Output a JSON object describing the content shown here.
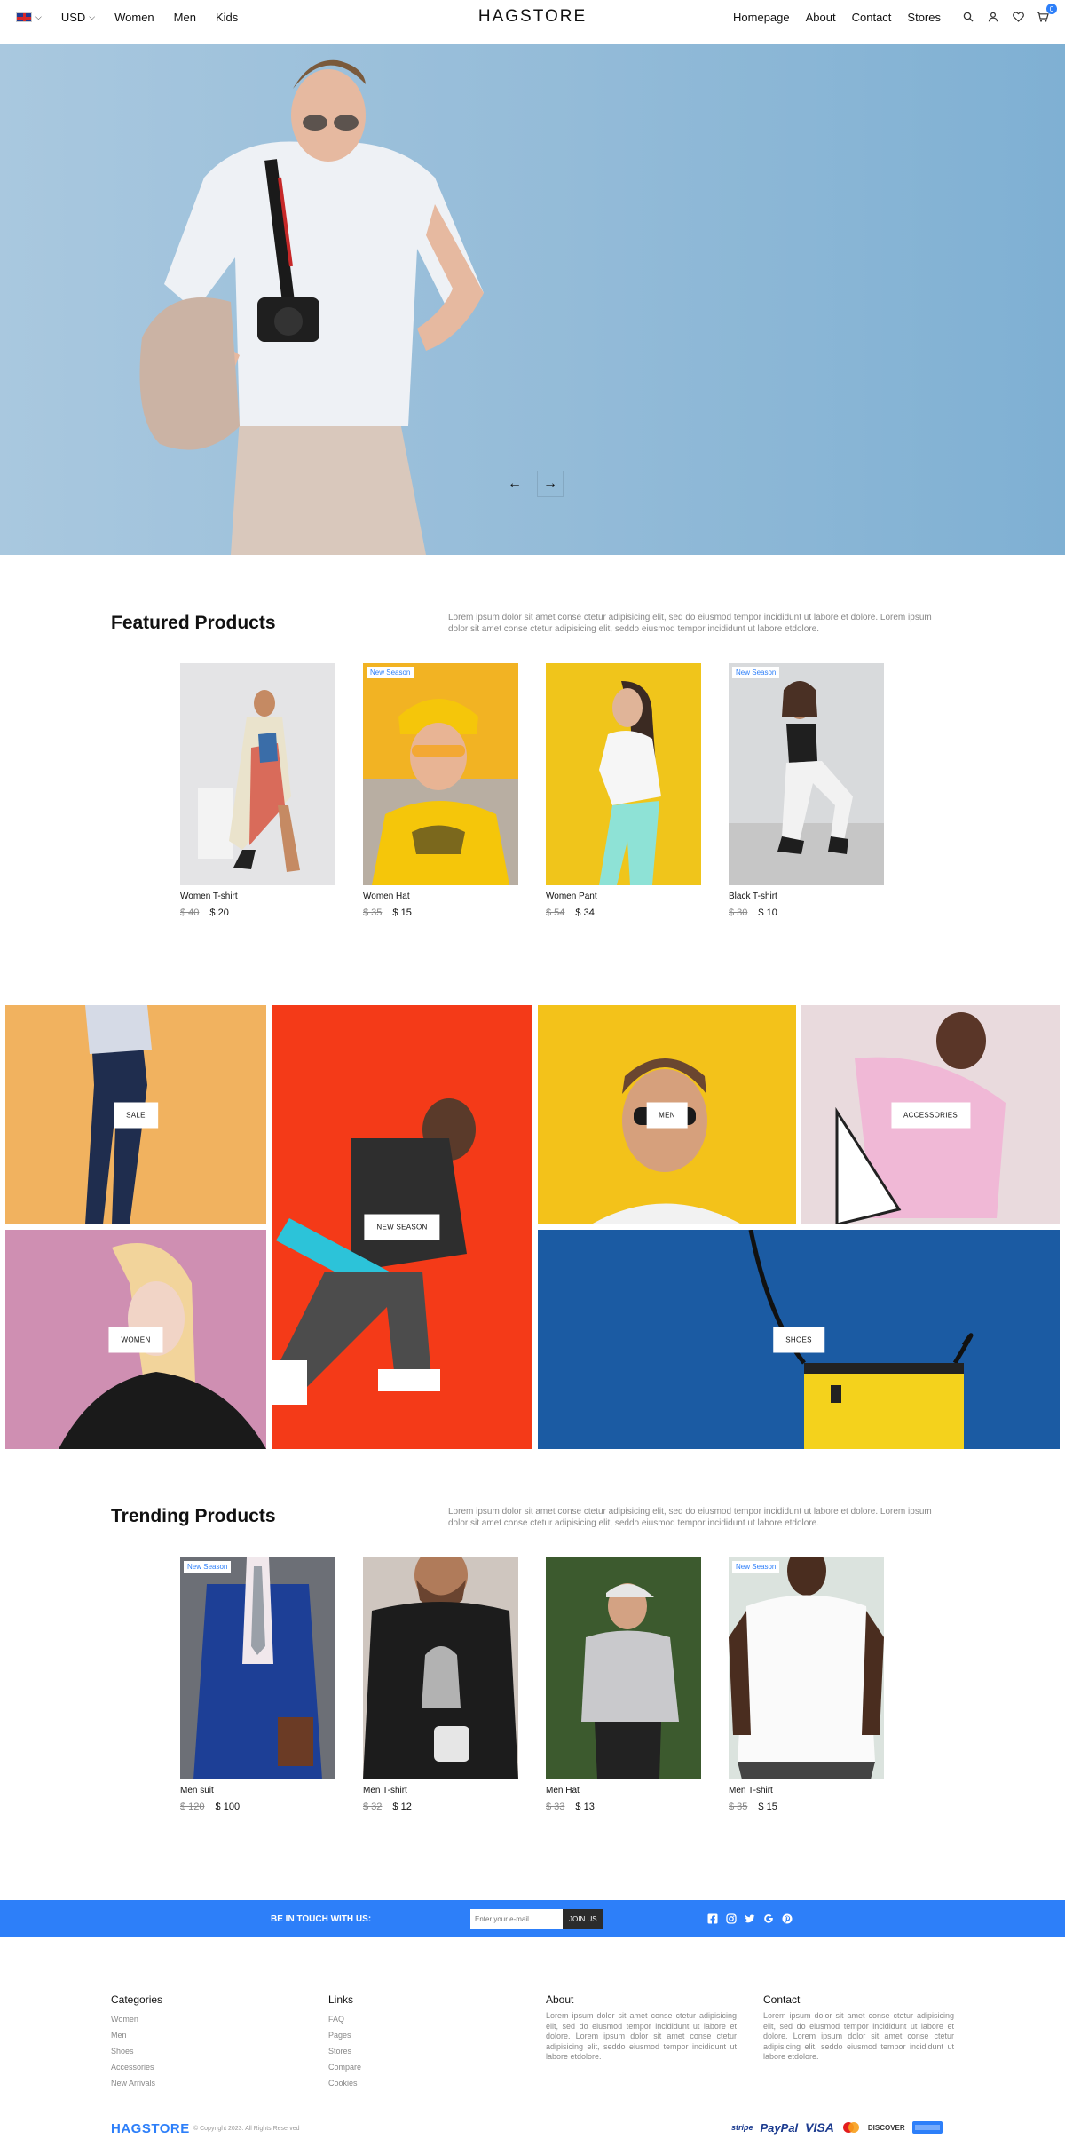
{
  "nav": {
    "language": "EN",
    "currency": "USD",
    "left_links": [
      "Women",
      "Men",
      "Kids"
    ],
    "logo": "HAGSTORE",
    "right_links": [
      "Homepage",
      "About",
      "Contact",
      "Stores"
    ],
    "cart_count": "0"
  },
  "featured": {
    "title": "Featured Products",
    "description": "Lorem ipsum dolor sit amet conse ctetur adipisicing elit, sed do eiusmod tempor incididunt ut labore et dolore. Lorem ipsum dolor sit amet conse ctetur adipisicing elit, seddo eiusmod tempor incididunt ut labore etdolore.",
    "products": [
      {
        "name": "Women T-shirt",
        "old_price": "$ 40",
        "price": "$ 20",
        "tag": ""
      },
      {
        "name": "Women Hat",
        "old_price": "$ 35",
        "price": "$ 15",
        "tag": "New Season"
      },
      {
        "name": "Women Pant",
        "old_price": "$ 54",
        "price": "$ 34",
        "tag": ""
      },
      {
        "name": "Black T-shirt",
        "old_price": "$ 30",
        "price": "$ 10",
        "tag": "New Season"
      }
    ]
  },
  "categories": {
    "sale": "SALE",
    "women": "WOMEN",
    "new_season": "NEW SEASON",
    "men": "MEN",
    "accessories": "ACCESSORIES",
    "shoes": "SHOES"
  },
  "trending": {
    "title": "Trending Products",
    "description": "Lorem ipsum dolor sit amet conse ctetur adipisicing elit, sed do eiusmod tempor incididunt ut labore et dolore. Lorem ipsum dolor sit amet conse ctetur adipisicing elit, seddo eiusmod tempor incididunt ut labore etdolore.",
    "products": [
      {
        "name": "Men suit",
        "old_price": "$ 120",
        "price": "$ 100",
        "tag": "New Season"
      },
      {
        "name": "Men T-shirt",
        "old_price": "$ 32",
        "price": "$ 12",
        "tag": ""
      },
      {
        "name": "Men Hat",
        "old_price": "$ 33",
        "price": "$ 13",
        "tag": ""
      },
      {
        "name": "Men T-shirt",
        "old_price": "$ 35",
        "price": "$ 15",
        "tag": "New Season"
      }
    ]
  },
  "newsletter": {
    "text": "BE IN TOUCH WITH US:",
    "placeholder": "Enter your e-mail...",
    "button": "JOIN US"
  },
  "footer": {
    "categories": {
      "title": "Categories",
      "items": [
        "Women",
        "Men",
        "Shoes",
        "Accessories",
        "New Arrivals"
      ]
    },
    "links": {
      "title": "Links",
      "items": [
        "FAQ",
        "Pages",
        "Stores",
        "Compare",
        "Cookies"
      ]
    },
    "about": {
      "title": "About",
      "text": "Lorem ipsum dolor sit amet conse ctetur adipisicing elit, sed do eiusmod tempor incididunt ut labore et dolore. Lorem ipsum dolor sit amet conse ctetur adipisicing elit, seddo eiusmod tempor incididunt ut labore etdolore."
    },
    "contact": {
      "title": "Contact",
      "text": "Lorem ipsum dolor sit amet conse ctetur adipisicing elit, sed do eiusmod tempor incididunt ut labore et dolore. Lorem ipsum dolor sit amet conse ctetur adipisicing elit, seddo eiusmod tempor incididunt ut labore etdolore."
    },
    "logo": "HAGSTORE",
    "copyright": "© Copyright 2023. All Rights Reserved",
    "payments": [
      "stripe",
      "PayPal",
      "VISA",
      "DISCOVER"
    ]
  },
  "colors": {
    "accent": "#2d7ff9"
  }
}
